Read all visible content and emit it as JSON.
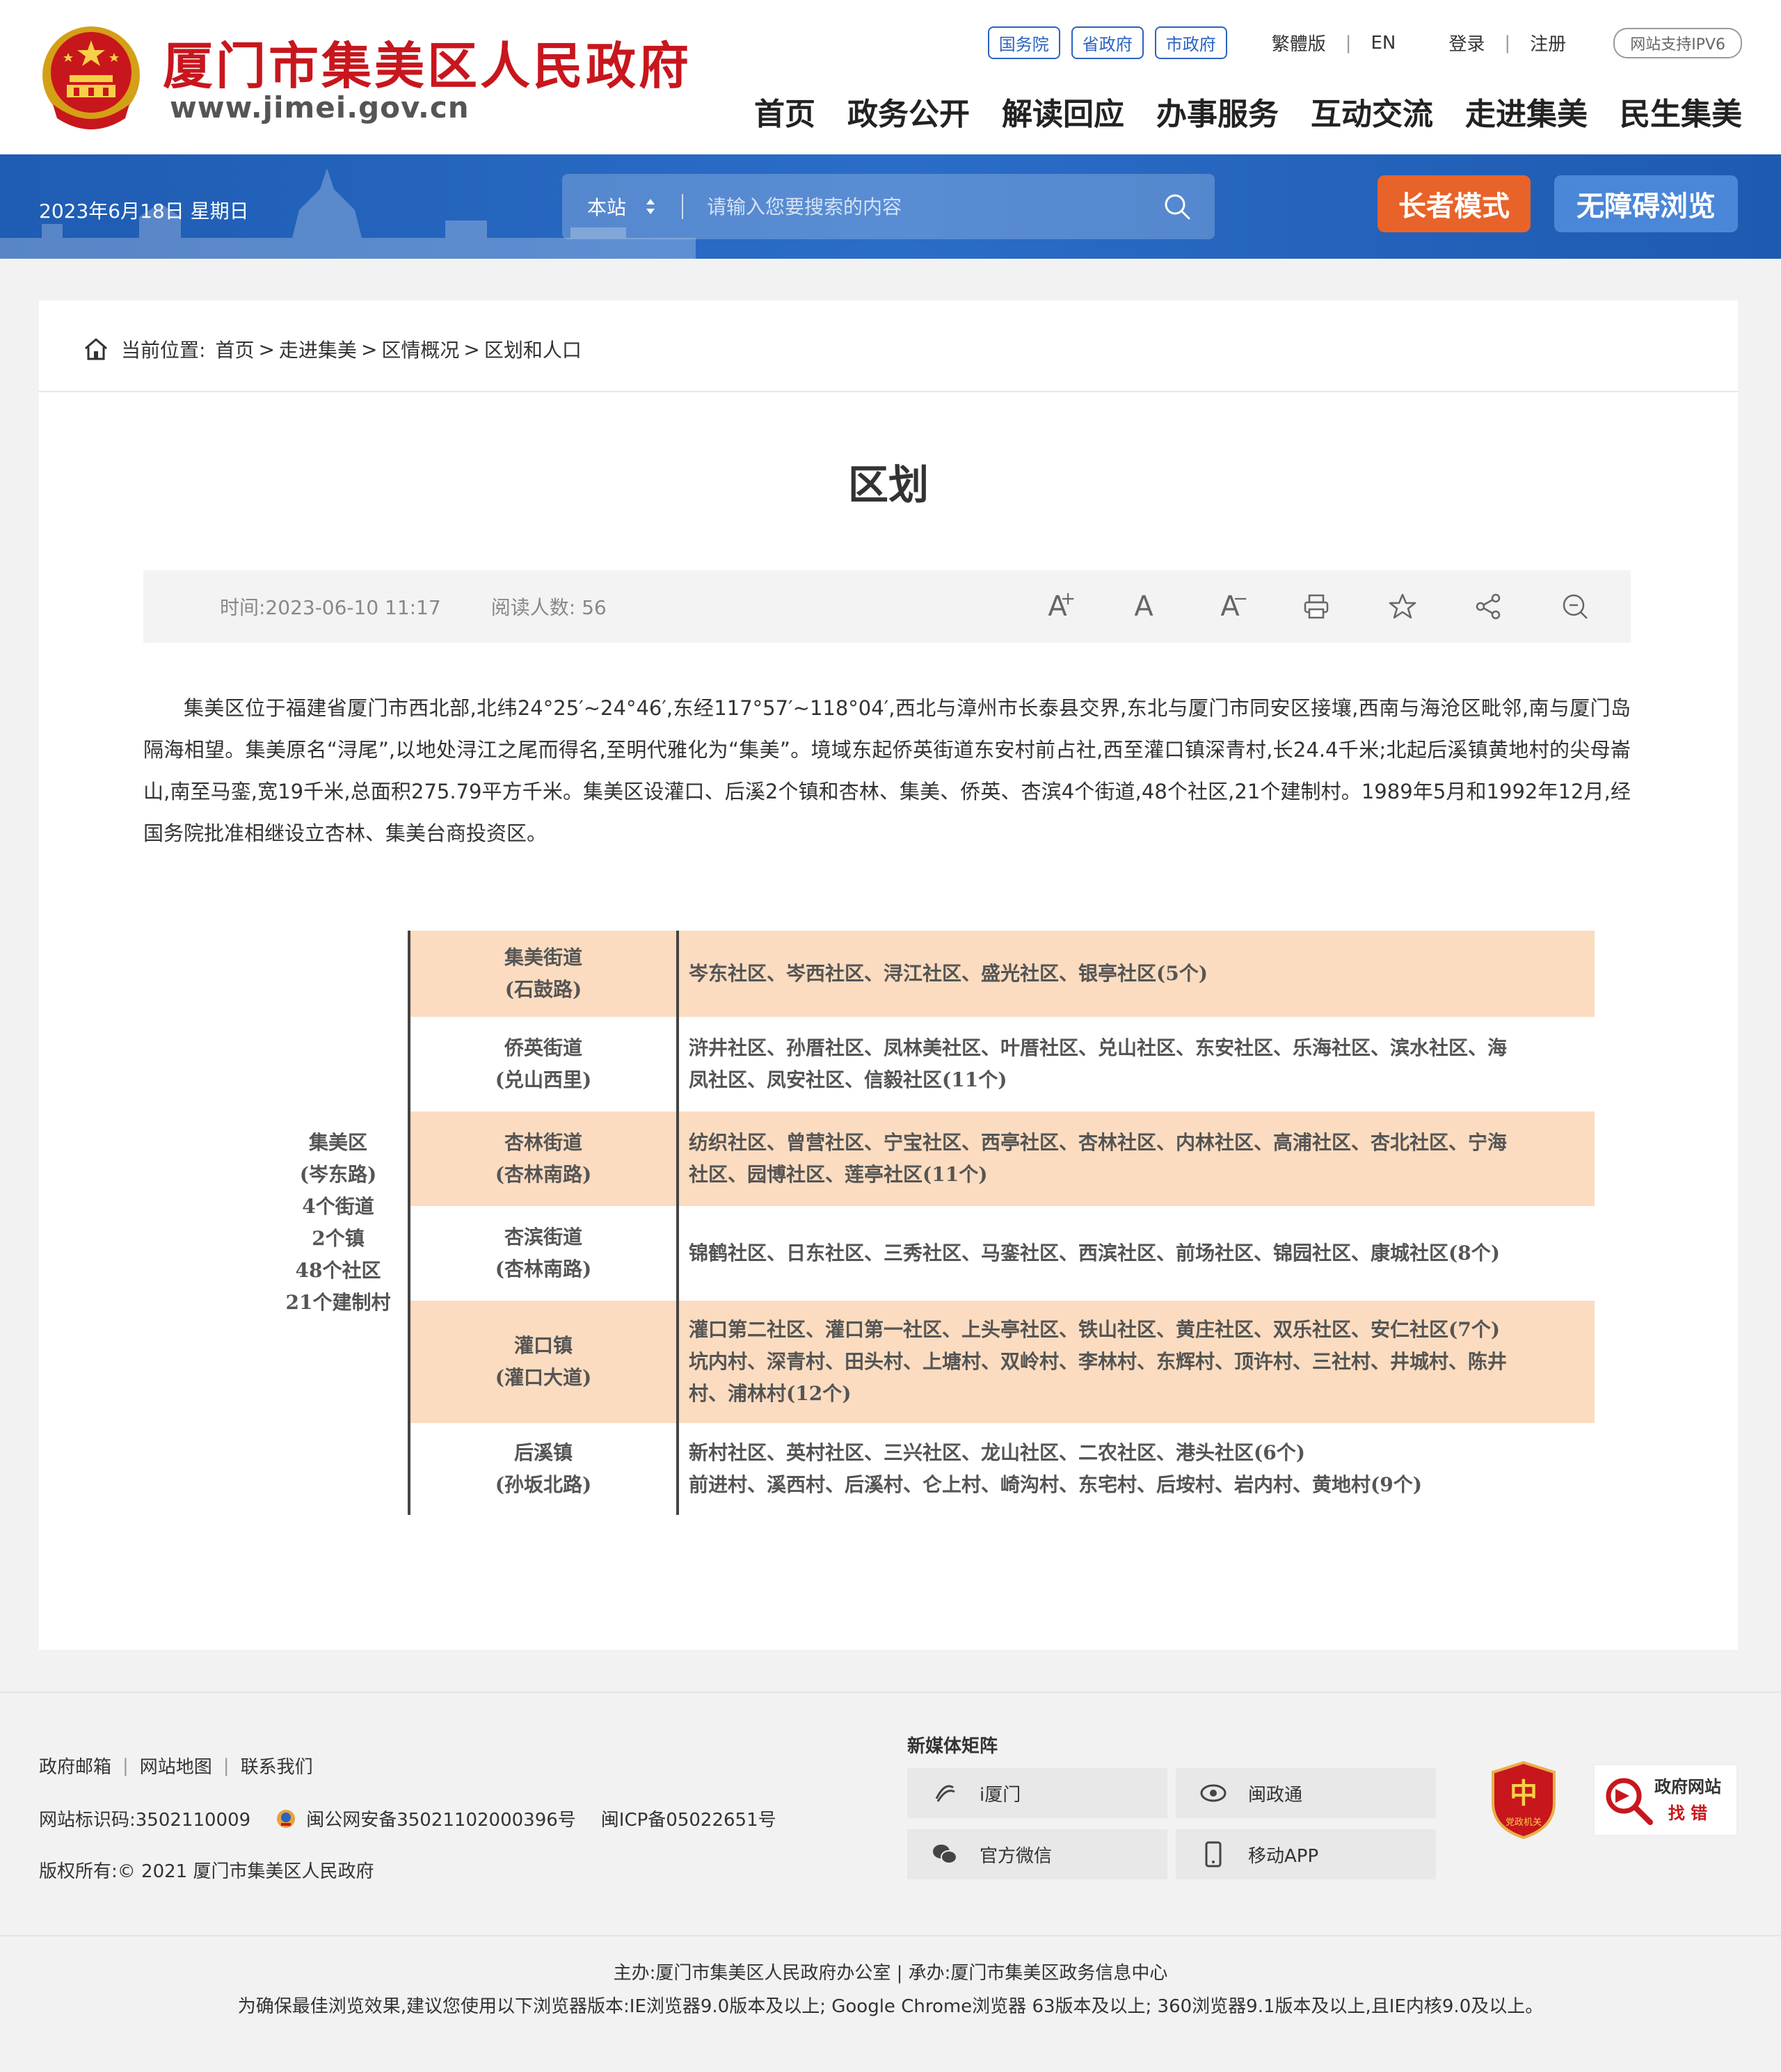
{
  "header": {
    "site_name": "厦门市集美区人民政府",
    "site_url": "www.jimei.gov.cn",
    "gov_links": [
      "国务院",
      "省政府",
      "市政府"
    ],
    "lang_trad": "繁體版",
    "lang_en": "EN",
    "login": "登录",
    "register": "注册",
    "ipv6": "网站支持IPV6",
    "nav": [
      "首页",
      "政务公开",
      "解读回应",
      "办事服务",
      "互动交流",
      "走进集美",
      "民生集美"
    ],
    "accent_color": "#c8161d"
  },
  "band": {
    "date": "2023年6月18日 星期日",
    "search_scope": "本站",
    "search_placeholder": "请输入您要搜索的内容",
    "elder_mode": "长者模式",
    "accessible": "无障碍浏览"
  },
  "breadcrumb": {
    "label": "当前位置:",
    "items": [
      "首页",
      "走进集美",
      "区情概况",
      "区划和人口"
    ]
  },
  "article": {
    "title": "区划",
    "time": "时间:2023-06-10 11:17",
    "reads": "阅读人数: 56",
    "tools": {
      "font_up": "A",
      "font_normal": "A",
      "font_down": "A"
    },
    "body": "集美区位于福建省厦门市西北部,北纬24°25′~24°46′,东经117°57′~118°04′,西北与漳州市长泰县交界,东北与厦门市同安区接壤,西南与海沧区毗邻,南与厦门岛隔海相望。集美原名“浔尾”,以地处浔江之尾而得名,至明代雅化为“集美”。境域东起侨英街道东安村前占社,西至灌口镇深青村,长24.4千米;北起后溪镇黄地村的尖母崙山,南至马銮,宽19千米,总面积275.79平方千米。集美区设灌口、后溪2个镇和杏林、集美、侨英、杏滨4个街道,48个社区,21个建制村。1989年5月和1992年12月,经国务院批准相继设立杏林、集美台商投资区。"
  },
  "district": {
    "left": [
      "集美区",
      "(岑东路)",
      "4个街道",
      "2个镇",
      "48个社区",
      "21个建制村"
    ],
    "rows": [
      {
        "name": "集美街道",
        "addr": "(石鼓路)",
        "lines": [
          "岑东社区、岑西社区、浔江社区、盛光社区、银亭社区(5个)"
        ]
      },
      {
        "name": "侨英街道",
        "addr": "(兑山西里)",
        "lines": [
          "浒井社区、孙厝社区、凤林美社区、叶厝社区、兑山社区、东安社区、乐海社区、滨水社区、海",
          "凤社区、凤安社区、信毅社区(11个)"
        ]
      },
      {
        "name": "杏林街道",
        "addr": "(杏林南路)",
        "lines": [
          "纺织社区、曾营社区、宁宝社区、西亭社区、杏林社区、内林社区、高浦社区、杏北社区、宁海",
          "社区、园博社区、莲亭社区(11个)"
        ]
      },
      {
        "name": "杏滨街道",
        "addr": "(杏林南路)",
        "lines": [
          "锦鹤社区、日东社区、三秀社区、马銮社区、西滨社区、前场社区、锦园社区、康城社区(8个)"
        ]
      },
      {
        "name": "灌口镇",
        "addr": "(灌口大道)",
        "lines": [
          "灌口第二社区、灌口第一社区、上头亭社区、铁山社区、黄庄社区、双乐社区、安仁社区(7个)",
          "坑内村、深青村、田头村、上塘村、双岭村、李林村、东辉村、顶许村、三社村、井城村、陈井",
          "村、浦林村(12个)"
        ]
      },
      {
        "name": "后溪镇",
        "addr": "(孙坂北路)",
        "lines": [
          "新村社区、英村社区、三兴社区、龙山社区、二农社区、港头社区(6个)",
          "前进村、溪西村、后溪村、仑上村、崎沟村、东宅村、后垵村、岩内村、黄地村(9个)"
        ]
      }
    ]
  },
  "footer": {
    "links": [
      "政府邮箱",
      "网站地图",
      "联系我们"
    ],
    "site_id": "网站标识码:3502110009",
    "police": "闽公网安备35021102000396号",
    "icp": "闽ICP备05022651号",
    "copyright": "版权所有:© 2021 厦门市集美区人民政府",
    "media_title": "新媒体矩阵",
    "media": [
      "i厦门",
      "闽政通",
      "官方微信",
      "移动APP"
    ],
    "badge_party": "党政机关",
    "badge_error_1": "政府网站",
    "badge_error_2": "找 错",
    "sponsor": "主办:厦门市集美区人民政府办公室 | 承办:厦门市集美区政务信息中心",
    "browser_note": "为确保最佳浏览效果,建议您使用以下浏览器版本:IE浏览器9.0版本及以上; Google Chrome浏览器 63版本及以上; 360浏览器9.1版本及以上,且IE内核9.0及以上。"
  }
}
